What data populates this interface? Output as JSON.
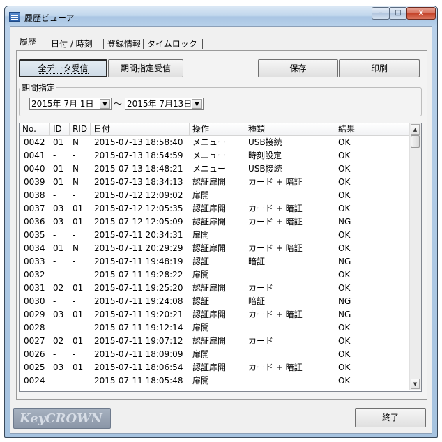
{
  "window": {
    "title": "履歴ビューア",
    "minimize": "–",
    "maximize": "□",
    "close": "x"
  },
  "tabs": [
    "履歴",
    "日付 / 時刻",
    "登録情報",
    "タイムロック"
  ],
  "toolbar": {
    "receive_all": "全データ受信",
    "receive_period": "期間指定受信",
    "save": "保存",
    "print": "印刷"
  },
  "period": {
    "legend": "期間指定",
    "from": "2015年 7月 1日",
    "separator": "～",
    "to": "2015年 7月13日"
  },
  "table": {
    "columns": [
      "No.",
      "ID",
      "RID",
      "日付",
      "操作",
      "種類",
      "結果"
    ],
    "rows": [
      [
        "0042",
        "01",
        "N",
        "2015-07-13 18:58:40",
        "メニュー",
        "USB接続",
        "OK"
      ],
      [
        "0041",
        "-",
        "-",
        "2015-07-13 18:54:59",
        "メニュー",
        "時刻設定",
        "OK"
      ],
      [
        "0040",
        "01",
        "N",
        "2015-07-13 18:48:21",
        "メニュー",
        "USB接続",
        "OK"
      ],
      [
        "0039",
        "01",
        "N",
        "2015-07-13 18:34:13",
        "認証扉開",
        "カード + 暗証",
        "OK"
      ],
      [
        "0038",
        "-",
        "-",
        "2015-07-12 12:09:02",
        "扉開",
        "",
        "OK"
      ],
      [
        "0037",
        "03",
        "01",
        "2015-07-12 12:05:35",
        "認証扉開",
        "カード + 暗証",
        "OK"
      ],
      [
        "0036",
        "03",
        "01",
        "2015-07-12 12:05:09",
        "認証扉開",
        "カード + 暗証",
        "NG"
      ],
      [
        "0035",
        "-",
        "-",
        "2015-07-11 20:34:31",
        "扉開",
        "",
        "OK"
      ],
      [
        "0034",
        "01",
        "N",
        "2015-07-11 20:29:29",
        "認証扉開",
        "カード + 暗証",
        "OK"
      ],
      [
        "0033",
        "-",
        "-",
        "2015-07-11 19:48:19",
        "認証",
        "暗証",
        "NG"
      ],
      [
        "0032",
        "-",
        "-",
        "2015-07-11 19:28:22",
        "扉開",
        "",
        "OK"
      ],
      [
        "0031",
        "02",
        "01",
        "2015-07-11 19:25:20",
        "認証扉開",
        "カード",
        "OK"
      ],
      [
        "0030",
        "-",
        "-",
        "2015-07-11 19:24:08",
        "認証",
        "暗証",
        "NG"
      ],
      [
        "0029",
        "03",
        "01",
        "2015-07-11 19:20:21",
        "認証扉開",
        "カード + 暗証",
        "NG"
      ],
      [
        "0028",
        "-",
        "-",
        "2015-07-11 19:12:14",
        "扉開",
        "",
        "OK"
      ],
      [
        "0027",
        "02",
        "01",
        "2015-07-11 19:07:12",
        "認証扉開",
        "カード",
        "OK"
      ],
      [
        "0026",
        "-",
        "-",
        "2015-07-11 18:09:09",
        "扉開",
        "",
        "OK"
      ],
      [
        "0025",
        "03",
        "01",
        "2015-07-11 18:06:54",
        "認証扉開",
        "カード + 暗証",
        "OK"
      ],
      [
        "0024",
        "-",
        "-",
        "2015-07-11 18:05:48",
        "扉開",
        "",
        "OK"
      ]
    ]
  },
  "footer": {
    "logo": "KeyCROWN",
    "close": "終了"
  }
}
